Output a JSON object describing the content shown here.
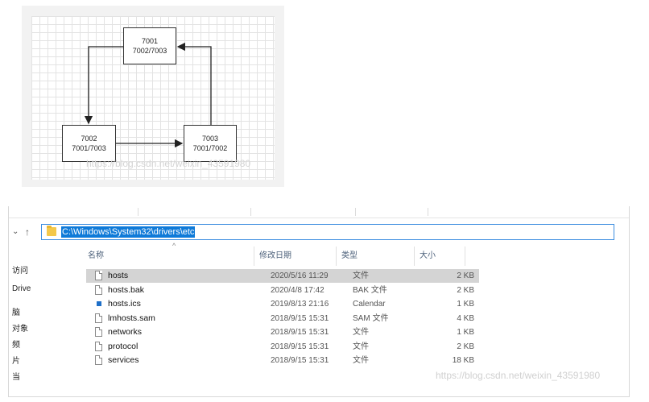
{
  "diagram": {
    "nodes": [
      {
        "id": "7001",
        "line1": "7001",
        "line2": "7002/7003"
      },
      {
        "id": "7002",
        "line1": "7002",
        "line2": "7001/7003"
      },
      {
        "id": "7003",
        "line1": "7003",
        "line2": "7001/7002"
      }
    ],
    "watermark": "https://blog.csdn.net/weixin_43591980"
  },
  "explorer": {
    "address": "C:\\Windows\\System32\\drivers\\etc",
    "sidebar": [
      "访问",
      "Drive",
      "脑",
      "对象",
      "频",
      "片",
      "当"
    ],
    "columns": {
      "name": "名称",
      "date": "修改日期",
      "type": "类型",
      "size": "大小"
    },
    "files": [
      {
        "name": "hosts",
        "date": "2020/5/16 11:29",
        "type": "文件",
        "size": "2 KB",
        "icon": "file-icon",
        "selected": true
      },
      {
        "name": "hosts.bak",
        "date": "2020/4/8 17:42",
        "type": "BAK 文件",
        "size": "2 KB",
        "icon": "file-icon"
      },
      {
        "name": "hosts.ics",
        "date": "2019/8/13 21:16",
        "type": "Calendar",
        "size": "1 KB",
        "icon": "calendar-icon"
      },
      {
        "name": "lmhosts.sam",
        "date": "2018/9/15 15:31",
        "type": "SAM 文件",
        "size": "4 KB",
        "icon": "file-icon"
      },
      {
        "name": "networks",
        "date": "2018/9/15 15:31",
        "type": "文件",
        "size": "1 KB",
        "icon": "file-icon"
      },
      {
        "name": "protocol",
        "date": "2018/9/15 15:31",
        "type": "文件",
        "size": "2 KB",
        "icon": "file-icon"
      },
      {
        "name": "services",
        "date": "2018/9/15 15:31",
        "type": "文件",
        "size": "18 KB",
        "icon": "file-icon"
      }
    ],
    "watermark": "https://blog.csdn.net/weixin_43591980"
  }
}
